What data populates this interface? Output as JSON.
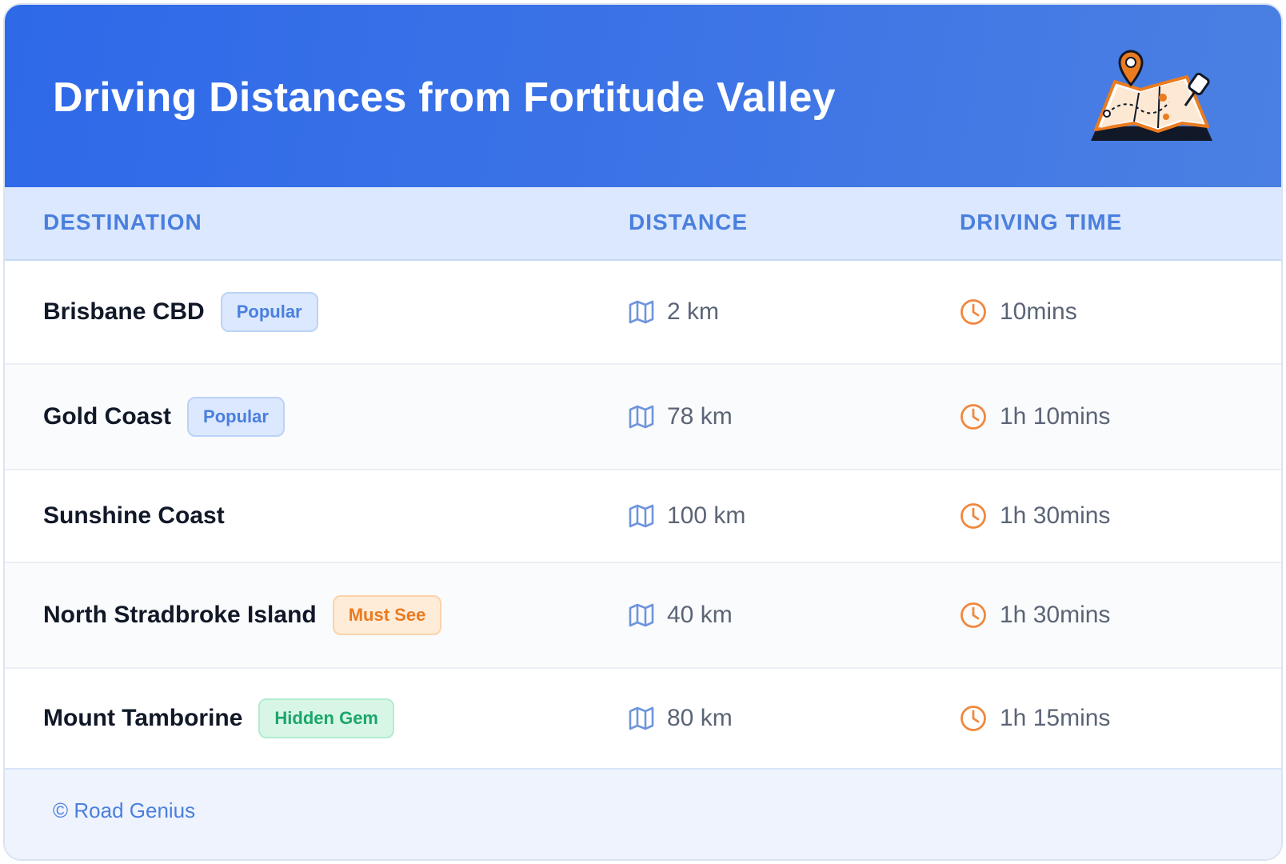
{
  "header": {
    "title": "Driving Distances from Fortitude Valley"
  },
  "table": {
    "columns": [
      "DESTINATION",
      "DISTANCE",
      "DRIVING TIME"
    ],
    "rows": [
      {
        "destination": "Brisbane CBD",
        "badge": "Popular",
        "distance": "2 km",
        "time": "10mins"
      },
      {
        "destination": "Gold Coast",
        "badge": "Popular",
        "distance": "78 km",
        "time": "1h 10mins"
      },
      {
        "destination": "Sunshine Coast",
        "badge": "",
        "distance": "100 km",
        "time": "1h 30mins"
      },
      {
        "destination": "North Stradbroke Island",
        "badge": "Must See",
        "distance": "40 km",
        "time": "1h 30mins"
      },
      {
        "destination": "Mount Tamborine",
        "badge": "Hidden Gem",
        "distance": "80 km",
        "time": "1h 15mins"
      }
    ]
  },
  "icons": {
    "distance": "map-icon",
    "time": "clock-icon",
    "header": "map-pin-illustration"
  },
  "colors": {
    "accent": "#2e69e8",
    "popular": "#4a7fde",
    "must_see": "#ea7b1f",
    "hidden_gem": "#1ba66a",
    "clock": "#f0883e"
  },
  "footer": {
    "credit": "© Road Genius"
  }
}
